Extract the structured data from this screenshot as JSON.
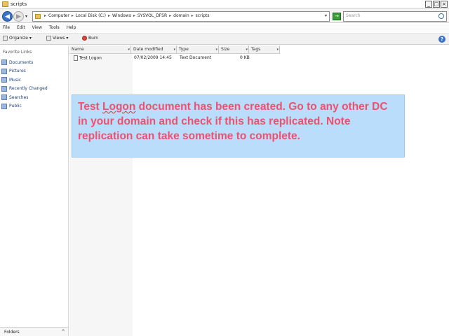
{
  "window": {
    "title": "scripts",
    "controls": [
      "_",
      "□",
      "×"
    ]
  },
  "address_bar": {
    "crumbs": [
      "Computer",
      "Local Disk (C:)",
      "Windows",
      "SYSVOL_DFSR",
      "domain",
      "scripts"
    ],
    "search_placeholder": "Search",
    "go_label": "→"
  },
  "menu": {
    "items": [
      "File",
      "Edit",
      "View",
      "Tools",
      "Help"
    ]
  },
  "toolbar": {
    "organize_label": "Organize",
    "views_label": "Views",
    "burn_label": "Burn",
    "help_label": "?"
  },
  "sidebar": {
    "heading": "Favorite Links",
    "links": [
      "Documents",
      "Pictures",
      "Music",
      "Recently Changed",
      "Searches",
      "Public"
    ],
    "folders_label": "Folders",
    "folders_chevron": "^"
  },
  "file_list": {
    "columns": [
      "Name",
      "Date modified",
      "Type",
      "Size",
      "Tags"
    ],
    "rows": [
      {
        "name": "Test Logon",
        "date_modified": "07/02/2009 14:45",
        "type": "Text Document",
        "size": "0 KB",
        "tags": ""
      }
    ]
  },
  "callout": {
    "prefix": "Test ",
    "squiggle_word": "Logon",
    "suffix": " document has been created. Go to any other DC in your domain and check if this has replicated. Note replication can take sometime to complete."
  },
  "colors": {
    "callout_bg": "#b9ddfa",
    "callout_text": "#f04f6e",
    "back_button": "#3c74c8"
  }
}
